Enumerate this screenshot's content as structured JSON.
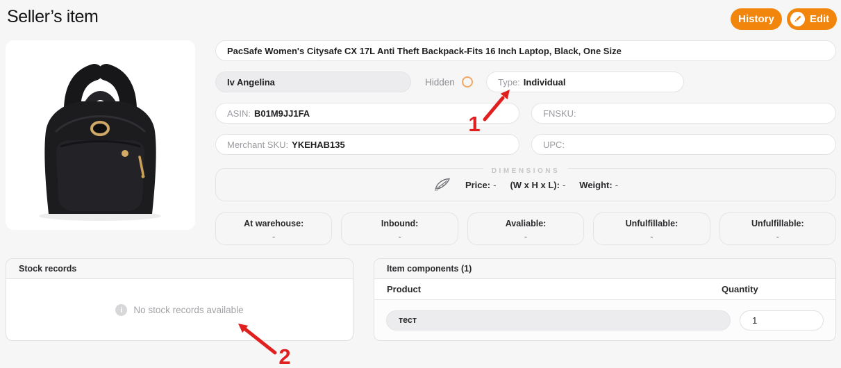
{
  "page": {
    "title": "Seller’s item"
  },
  "header": {
    "history_label": "History",
    "edit_label": "Edit"
  },
  "product": {
    "title": "PacSafe Women's Citysafe CX 17L Anti Theft Backpack-Fits 16 Inch Laptop, Black, One Size",
    "owner": "Iv Angelina",
    "hidden_label": "Hidden",
    "type_label": "Type:",
    "type_value": "Individual",
    "asin_label": "ASIN:",
    "asin_value": "B01M9JJ1FA",
    "fnsku_label": "FNSKU:",
    "fnsku_value": "",
    "merchant_sku_label": "Merchant SKU:",
    "merchant_sku_value": "YKEHAB135",
    "upc_label": "UPC:",
    "upc_value": ""
  },
  "dimensions": {
    "section_label": "DIMENSIONS",
    "price_label": "Price:",
    "price_value": "-",
    "whl_label": "(W x H x L):",
    "whl_value": "-",
    "weight_label": "Weight:",
    "weight_value": "-"
  },
  "stats": [
    {
      "label": "At warehouse:",
      "value": "-"
    },
    {
      "label": "Inbound:",
      "value": "-"
    },
    {
      "label": "Avaliable:",
      "value": "-"
    },
    {
      "label": "Unfulfillable:",
      "value": "-"
    },
    {
      "label": "Unfulfillable:",
      "value": "-"
    }
  ],
  "stock_records": {
    "title": "Stock records",
    "info_glyph": "i",
    "empty_message": "No stock records available"
  },
  "item_components": {
    "title": "Item components (1)",
    "columns": [
      "Product",
      "Quantity"
    ],
    "rows": [
      {
        "product": "тест",
        "quantity": "1"
      }
    ]
  },
  "annotations": [
    {
      "label": "1"
    },
    {
      "label": "2"
    }
  ],
  "colors": {
    "accent_orange": "#f2850b",
    "radio_orange": "#f2a763",
    "annotation_red": "#e01f1f"
  }
}
